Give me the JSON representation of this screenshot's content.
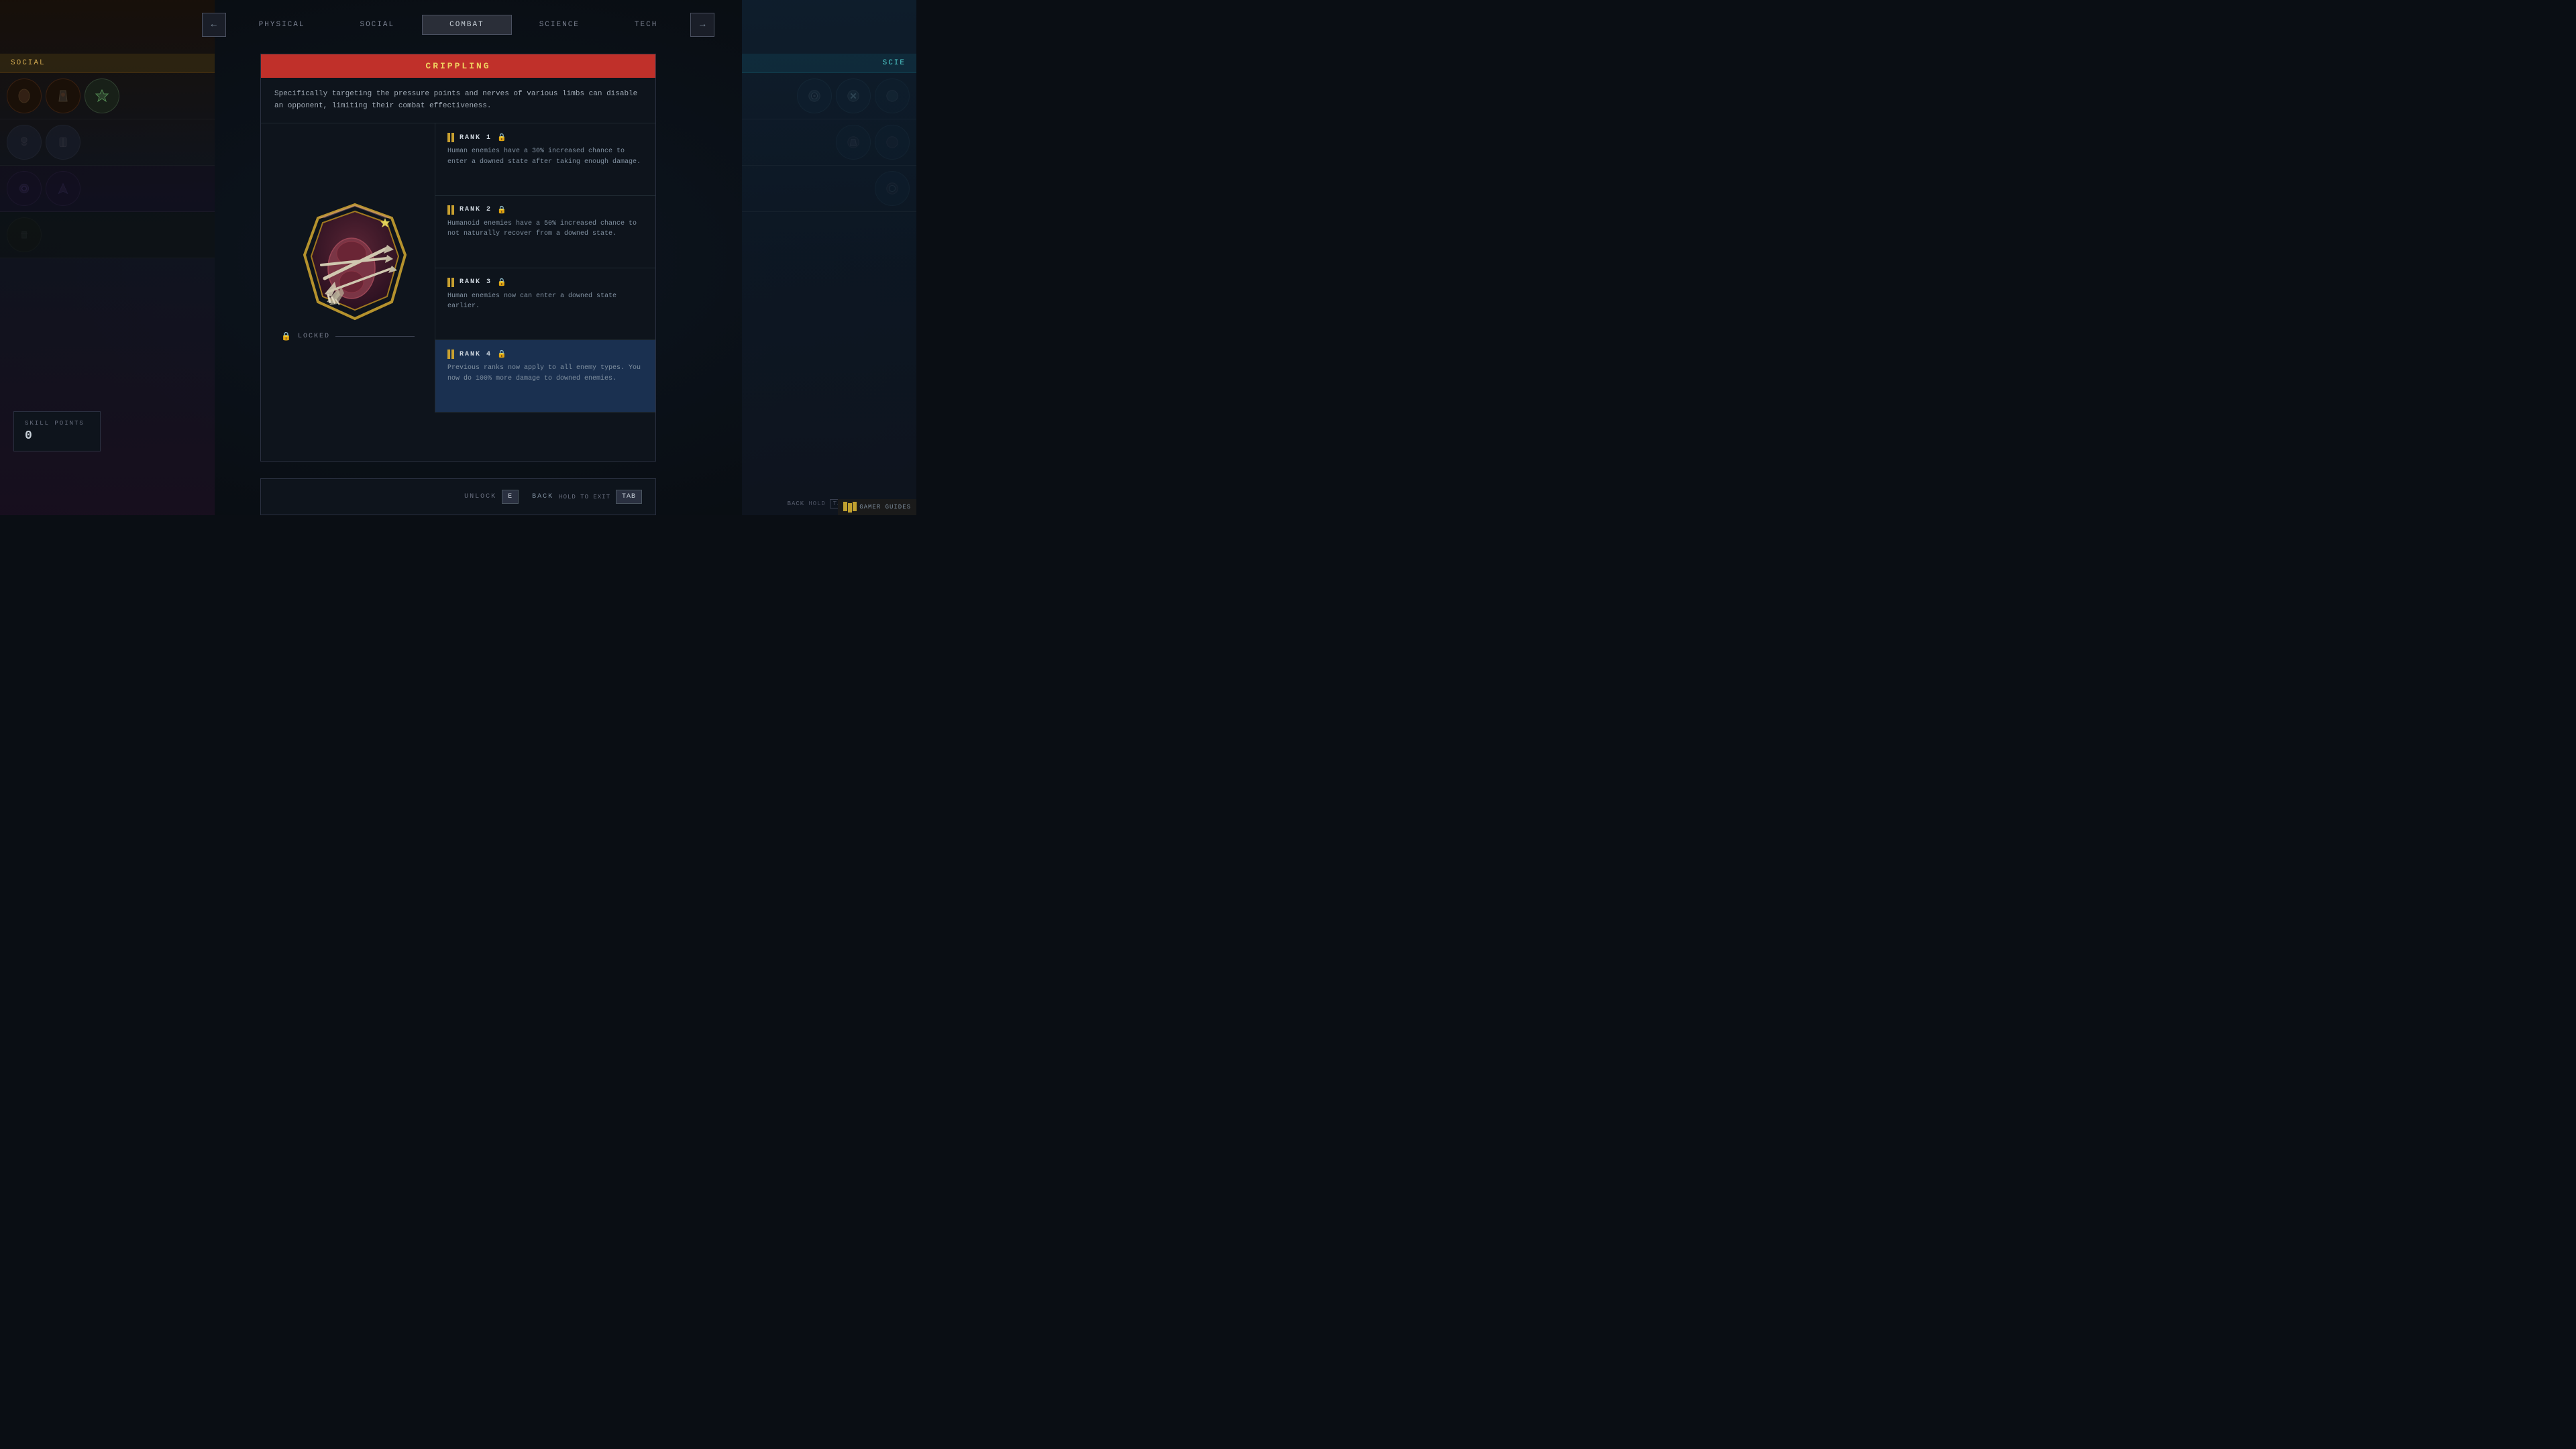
{
  "nav": {
    "tabs": [
      {
        "id": "physical",
        "label": "PHYSICAL",
        "active": false
      },
      {
        "id": "social",
        "label": "SOCIAL",
        "active": false
      },
      {
        "id": "combat",
        "label": "COMBAT",
        "active": true
      },
      {
        "id": "science",
        "label": "SCIENCE",
        "active": false
      },
      {
        "id": "tech",
        "label": "TECH",
        "active": false
      }
    ],
    "prev_arrow": "←",
    "next_arrow": "→"
  },
  "card": {
    "title": "CRIPPLING",
    "description": "Specifically targeting the pressure points and nerves of various limbs can disable an opponent, limiting their combat effectiveness.",
    "locked_label": "LOCKED",
    "ranks": [
      {
        "id": 1,
        "label": "RANK  1",
        "locked": true,
        "highlighted": false,
        "description": "Human enemies have a 30% increased chance to enter a downed state after taking enough damage."
      },
      {
        "id": 2,
        "label": "RANK  2",
        "locked": true,
        "highlighted": false,
        "description": "Humanoid enemies have a 50% increased chance to not naturally recover from a downed state."
      },
      {
        "id": 3,
        "label": "RANK  3",
        "locked": true,
        "highlighted": false,
        "description": "Human enemies now can enter a downed state earlier."
      },
      {
        "id": 4,
        "label": "RANK  4",
        "locked": true,
        "highlighted": true,
        "description": "Previous ranks now apply to all enemy types. You now do 100% more damage to downed enemies."
      }
    ]
  },
  "footer": {
    "unlock_label": "UNLOCK",
    "unlock_key": "E",
    "back_label": "BACK",
    "back_key": "TAB",
    "hold_to_exit": "HOLD TO EXIT"
  },
  "left_panel": {
    "section1_label": "SOCIAL",
    "section2_label": "SCIE"
  },
  "right_panel": {
    "header": "SCIE"
  },
  "skill_points": {
    "label": "SKILL POINTS",
    "value": "0"
  },
  "bottom_right": {
    "back_label": "BACK",
    "hold_label": "HOLD",
    "tab_label": "TAB",
    "brand": "GAMER GUIDES"
  }
}
